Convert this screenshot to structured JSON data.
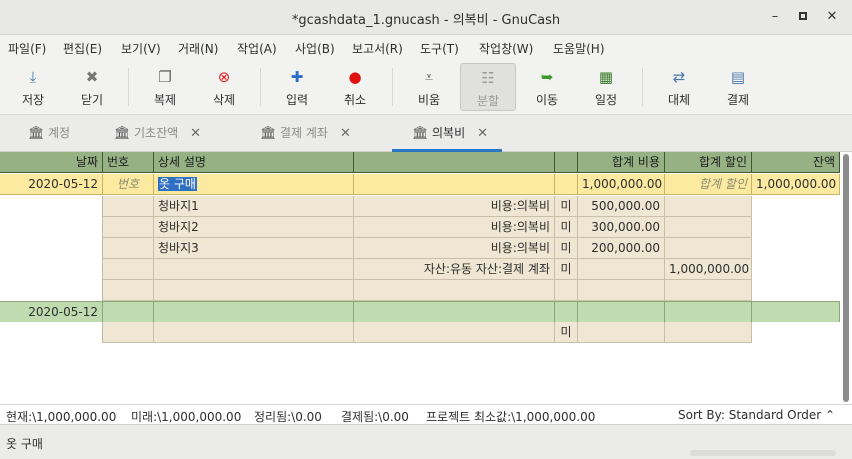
{
  "window": {
    "title": "*gcashdata_1.gnucash - 의복비 - GnuCash",
    "min": "–",
    "close": "✕"
  },
  "menu": [
    "파일(F)",
    "편집(E)",
    "보기(V)",
    "거래(N)",
    "작업(A)",
    "사업(B)",
    "보고서(R)",
    "도구(T)",
    "작업창(W)",
    "도움말(H)"
  ],
  "toolbar": {
    "save": "저장",
    "close": "닫기",
    "duplicate": "복제",
    "delete": "삭제",
    "enter": "입력",
    "cancel": "취소",
    "blank": "비움",
    "split": "분할",
    "jump": "이동",
    "schedule": "일정",
    "transfer": "대체",
    "reconcile": "결제",
    "icons": {
      "save": "save-icon",
      "close": "close-icon",
      "duplicate": "duplicate-icon",
      "delete": "delete-icon",
      "enter": "plus-icon",
      "cancel": "cancel-icon",
      "blank": "blank-icon",
      "split": "split-icon",
      "jump": "jump-icon",
      "schedule": "schedule-icon",
      "transfer": "transfer-icon",
      "reconcile": "reconcile-icon"
    }
  },
  "tabs": [
    {
      "label": "계정",
      "closable": false,
      "active": false
    },
    {
      "label": "기초잔액",
      "closable": true,
      "active": false
    },
    {
      "label": "결제 계좌",
      "closable": true,
      "active": false
    },
    {
      "label": "의복비",
      "closable": true,
      "active": true
    }
  ],
  "register": {
    "headers": {
      "date": "날짜",
      "num": "번호",
      "desc": "상세 설명",
      "transfer": "",
      "r": "",
      "debit": "합계 비용",
      "credit": "합계 할인",
      "balance": "잔액"
    },
    "txn": {
      "date": "2020-05-12",
      "num_placeholder": "번호",
      "desc": "옷 구매",
      "debit": "1,000,000.00",
      "credit_placeholder": "합계 할인",
      "balance": "1,000,000.00"
    },
    "splits": [
      {
        "memo": "청바지1",
        "account": "비용:의복비",
        "r": "미",
        "debit": "500,000.00",
        "credit": ""
      },
      {
        "memo": "청바지2",
        "account": "비용:의복비",
        "r": "미",
        "debit": "300,000.00",
        "credit": ""
      },
      {
        "memo": "청바지3",
        "account": "비용:의복비",
        "r": "미",
        "debit": "200,000.00",
        "credit": ""
      },
      {
        "memo": "",
        "account": "자산:유동 자산:결제 계좌",
        "r": "미",
        "debit": "",
        "credit": "1,000,000.00"
      }
    ],
    "blank_txn": {
      "date": "2020-05-12",
      "r": "미"
    }
  },
  "summary": {
    "present": "현재:\\1,000,000.00",
    "future": "미래:\\1,000,000.00",
    "cleared": "정리됨:\\0.00",
    "reconciled": "결제됨:\\0.00",
    "project_min": "프로젝트 최소값:\\1,000,000.00",
    "sort": "Sort By:  Standard Order ⌃"
  },
  "status": {
    "text": "옷 구매"
  }
}
